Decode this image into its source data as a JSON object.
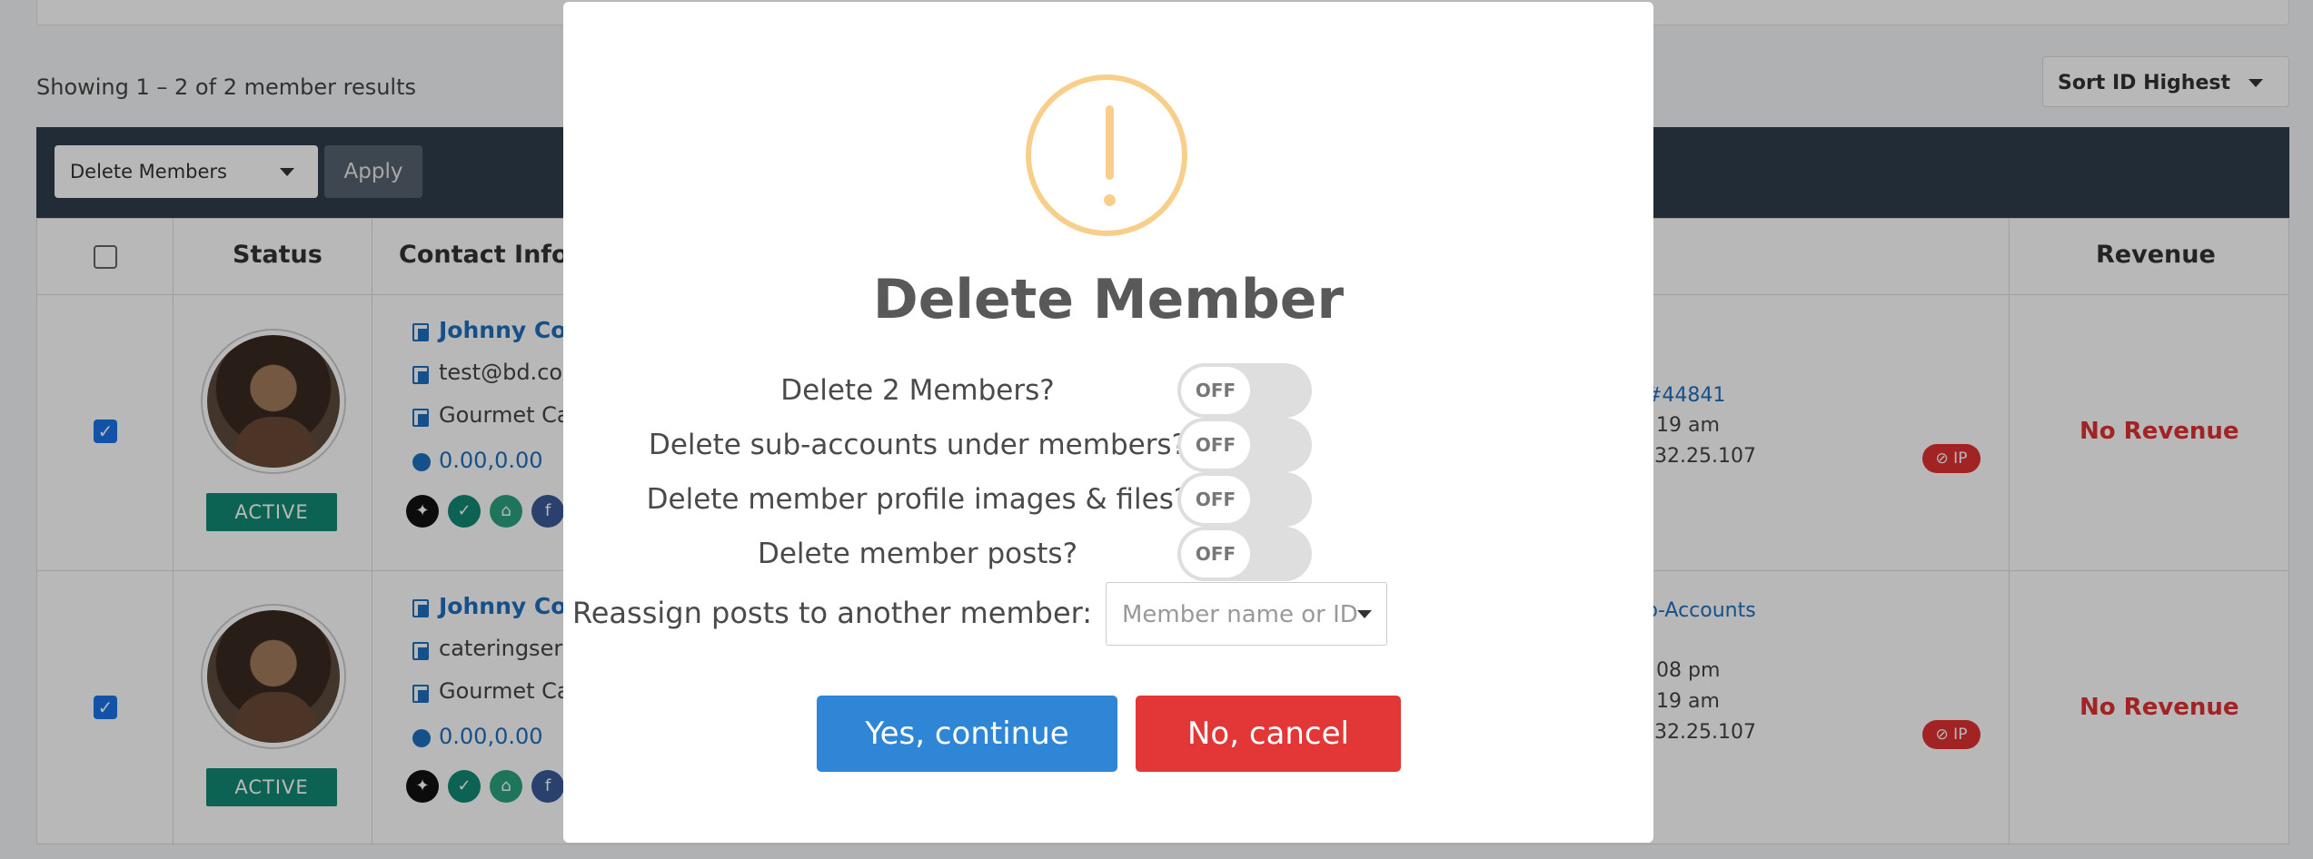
{
  "page": {
    "results_text": "Showing 1 – 2 of 2 member results",
    "sort_label": "Sort ID Highest",
    "bulk_action": "Delete Members",
    "apply_label": "Apply"
  },
  "table": {
    "headers": {
      "status": "Status",
      "contact": "Contact Inforn",
      "revenue": "Revenue"
    },
    "rows": [
      {
        "status": "ACTIVE",
        "name": "Johnny Coc",
        "email": "test@bd.co",
        "company": "Gourmet Ca",
        "coords": "0.00,0.00",
        "mid_link": "#44841",
        "time1": "19 am",
        "ip_text": "32.25.107",
        "ip_badge": "⊘ IP",
        "revenue": "No Revenue"
      },
      {
        "status": "ACTIVE",
        "name": "Johnny Coc",
        "email": "cateringser",
        "company": "Gourmet Ca",
        "coords": "0.00,0.00",
        "mid_link": "b-Accounts",
        "time0": "08 pm",
        "time1": "19 am",
        "ip_text": "32.25.107",
        "ip_badge": "⊘ IP",
        "revenue": "No Revenue"
      }
    ]
  },
  "modal": {
    "title": "Delete Member",
    "options": [
      {
        "label": "Delete 2 Members?",
        "state": "OFF"
      },
      {
        "label": "Delete sub-accounts under members?",
        "state": "OFF"
      },
      {
        "label": "Delete member profile images & files?",
        "state": "OFF"
      },
      {
        "label": "Delete member posts?",
        "state": "OFF"
      }
    ],
    "reassign_label": "Reassign posts to another member:",
    "member_placeholder": "Member name or ID",
    "yes_label": "Yes, continue",
    "no_label": "No, cancel"
  },
  "colors": {
    "warning": "#f8cf8a",
    "primary": "#2f86d6",
    "danger": "#e33636",
    "active_badge": "#138a73",
    "header_bar": "#2f3d4b"
  },
  "icons": [
    "warning-exclamation-icon",
    "copy-icon",
    "globe-icon",
    "pin-icon",
    "check-circle-icon",
    "home-icon",
    "facebook-icon",
    "caret-down-icon",
    "block-icon"
  ]
}
